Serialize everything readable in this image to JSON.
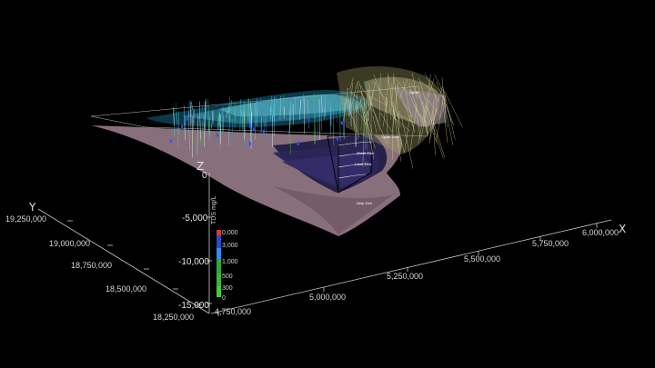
{
  "axes": {
    "x": {
      "letter": "X",
      "ticks": [
        "4,750,000",
        "5,000,000",
        "5,250,000",
        "5,500,000",
        "5,750,000",
        "6,000,000"
      ]
    },
    "y": {
      "letter": "Y",
      "ticks": [
        "19,250,000",
        "19,000,000",
        "18,750,000",
        "18,500,000",
        "18,250,000"
      ]
    },
    "z": {
      "letter": "Z",
      "ticks": [
        "0",
        "-5,000",
        "-10,000",
        "-15,000"
      ]
    }
  },
  "legend": {
    "title": "TDS mg/L",
    "values": [
      "0,000",
      "3,000",
      "1,000",
      "500",
      "300",
      "0"
    ],
    "colors": [
      "#d03a3a",
      "#2c49c8",
      "#2a8ef0",
      "#2fa83a",
      "#38b83a",
      "#3ccf3c"
    ]
  },
  "annotations": [
    "Aquifer",
    "Upper Zone",
    "Middle Zone",
    "Lower Zone",
    "Deep Zone"
  ],
  "colors": {
    "surface": "#8e7582",
    "layers": "#27224f",
    "wells_cyan": "#4fd0e6",
    "wells_yellow": "#d8d49a",
    "wells_green": "#57d64a",
    "axis": "#c8c8c8"
  }
}
